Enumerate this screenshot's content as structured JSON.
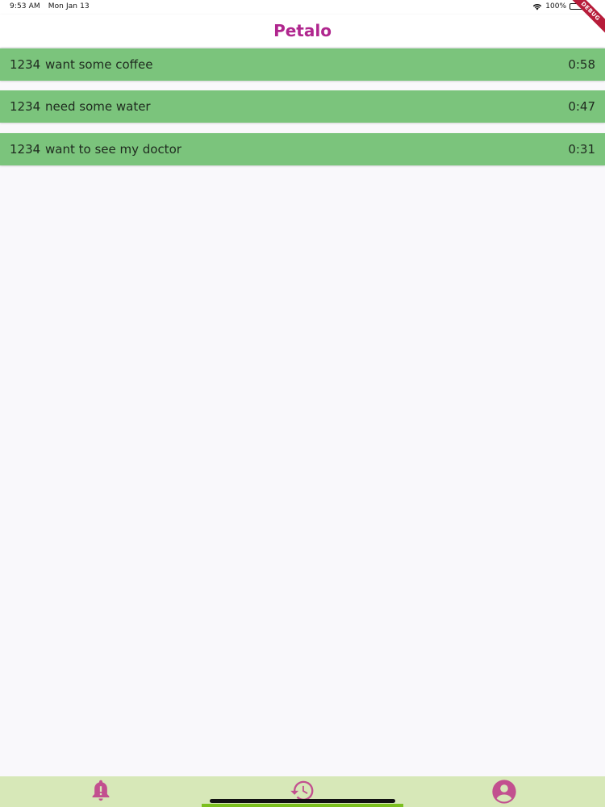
{
  "status_bar": {
    "time": "9:53 AM",
    "date": "Mon Jan 13",
    "battery": "100%"
  },
  "app_bar": {
    "title": "Petalo"
  },
  "debug_banner": {
    "label": "DEBUG"
  },
  "requests": [
    {
      "id": "1234",
      "message": "want some coffee",
      "elapsed": "0:58"
    },
    {
      "id": "1234",
      "message": "need some water",
      "elapsed": "0:47"
    },
    {
      "id": "1234",
      "message": "want to see my doctor",
      "elapsed": "0:31"
    }
  ],
  "bottom_nav": {
    "tabs": [
      {
        "icon": "bell-alert-icon"
      },
      {
        "icon": "history-icon",
        "selected": true
      },
      {
        "icon": "account-circle-icon"
      }
    ]
  },
  "colors": {
    "accent": "#b0268e",
    "item_background": "#7bc47c",
    "nav_background": "#d7e8b8",
    "nav_indicator": "#7bbf1e",
    "page_background": "#f9f8fb"
  }
}
